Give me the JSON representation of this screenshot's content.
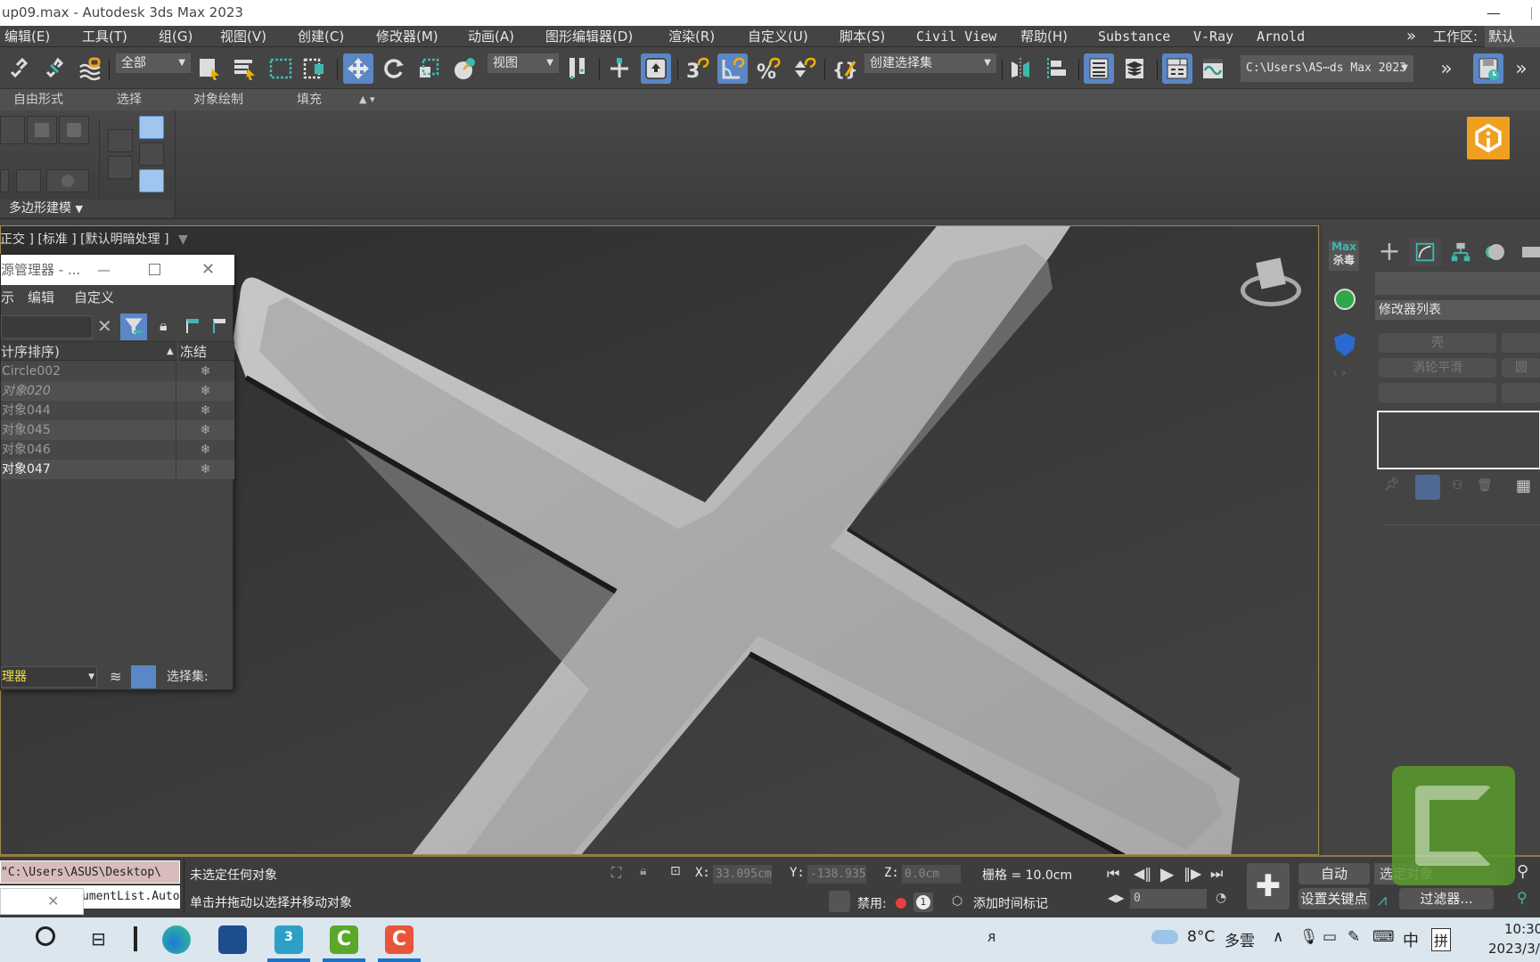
{
  "window": {
    "title": "up09.max - Autodesk 3ds Max 2023",
    "minimize_icon": "minimize-icon"
  },
  "menubar": {
    "items": [
      "编辑(E)",
      "工具(T)",
      "组(G)",
      "视图(V)",
      "创建(C)",
      "修改器(M)",
      "动画(A)",
      "图形编辑器(D)",
      "渲染(R)",
      "自定义(U)",
      "脚本(S)",
      "Civil View",
      "帮助(H)",
      "Substance",
      "V-Ray",
      "Arnold"
    ],
    "overflow": "»",
    "workspace_label": "工作区:",
    "workspace_value": "默认"
  },
  "toolbar": {
    "selection_filter": "全部",
    "ref_coord": "视图",
    "named_selection": "创建选择集",
    "project_path": "C:\\Users\\AS⋯ds Max 2023",
    "icons": [
      "link-icon",
      "unlink-icon",
      "bind-spacewarp-icon",
      "select-object-icon",
      "select-by-name-icon",
      "rect-selection-icon",
      "window-crossing-icon",
      "move-icon",
      "rotate-icon",
      "scale-icon",
      "placement-icon",
      "pivot-icon",
      "select-manipulate-icon",
      "keyboard-shortcut-icon",
      "snap-3d-icon",
      "angle-snap-icon",
      "percent-snap-icon",
      "spinner-snap-icon",
      "edit-named-sets-icon",
      "mirror-icon",
      "align-icon",
      "scene-explorer-icon",
      "layer-explorer-icon",
      "toggle-ribbon-icon",
      "curve-editor-icon",
      "overflow-icon",
      "autobackup-icon",
      "overflow-icon-2"
    ]
  },
  "ribbon": {
    "tabs": [
      "自由形式",
      "选择",
      "对象绘制",
      "填充"
    ],
    "panel_label": "多边形建模"
  },
  "viewport": {
    "label": "正交 ] [标准 ] [默认明暗处理 ]",
    "filter_icon": "filter-icon"
  },
  "scene_explorer": {
    "title": "源管理器 - ...",
    "menu": [
      "示",
      "编辑",
      "自定义"
    ],
    "column_name": "计序排序)",
    "column_freeze": "冻结",
    "rows": [
      {
        "name": "Circle002",
        "italic": false,
        "dim": true
      },
      {
        "name": "对象020",
        "italic": true,
        "dim": true
      },
      {
        "name": "对象044",
        "italic": false,
        "dim": true
      },
      {
        "name": "对象045",
        "italic": false,
        "dim": true
      },
      {
        "name": "对象046",
        "italic": false,
        "dim": true
      },
      {
        "name": "对象047",
        "italic": false,
        "dim": false
      }
    ],
    "footer_dropdown": "理器",
    "footer_selection_label": "选择集:"
  },
  "command_panel": {
    "side_badge_top": "Max",
    "side_badge_bottom": "杀毒",
    "modifier_list": "修改器列表",
    "modifier_buttons": [
      "壳",
      "",
      "涡轮平滑",
      "圆",
      "",
      ""
    ]
  },
  "status": {
    "maxscript_line1": "\"C:\\Users\\ASUS\\Desktop\\",
    "maxscript_line2": "umentList.Auto",
    "selection_status": "未选定任何对象",
    "prompt": "单击并拖动以选择并移动对象",
    "x_label": "X:",
    "x_value": "33.095cm",
    "y_label": "Y:",
    "y_value": "-138.935",
    "z_label": "Z:",
    "z_value": "0.0cm",
    "grid": "栅格 = 10.0cm",
    "disable_label": "禁用:",
    "badge_count": "1",
    "add_time_tag": "添加时间标记",
    "auto_key": "自动",
    "set_key": "设置关键点",
    "key_filter_dropdown": "选定对象",
    "filters": "过滤器...",
    "frame_value": "0"
  },
  "taskbar": {
    "weather_temp": "8°C",
    "weather_desc": "多雲",
    "ime_lang": "中",
    "ime_mode": "拼",
    "time": "10:30",
    "date": "2023/3/"
  },
  "colors": {
    "accent_blue": "#5b87c6",
    "viewport_border": "#a08a4a",
    "orange_badge": "#f0a020",
    "teal": "#3fb8b0"
  }
}
